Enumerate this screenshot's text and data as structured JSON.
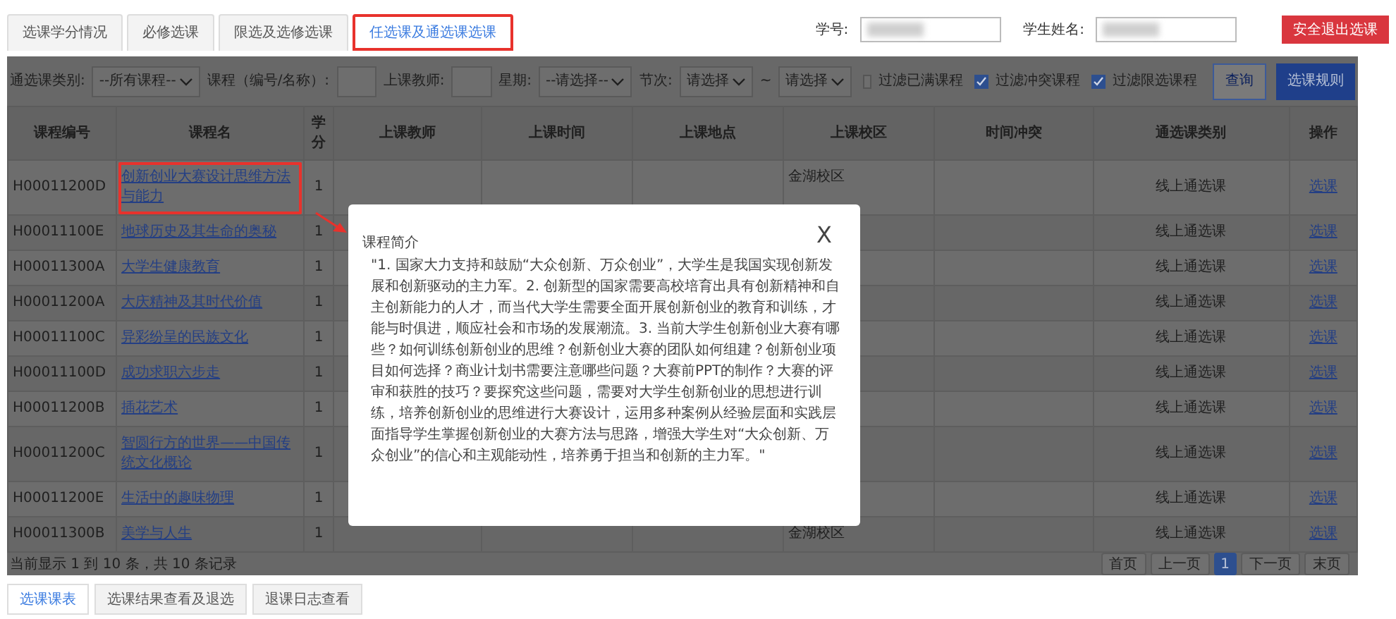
{
  "top_tabs": [
    {
      "label": "选课学分情况",
      "selected": false,
      "highlighted": false
    },
    {
      "label": "必修选课",
      "selected": false,
      "highlighted": false
    },
    {
      "label": "限选及选修选课",
      "selected": false,
      "highlighted": false
    },
    {
      "label": "任选课及通选课选课",
      "selected": true,
      "highlighted": true
    }
  ],
  "student": {
    "id_label": "学号:",
    "name_label": "学生姓名:",
    "logout_button": "安全退出选课"
  },
  "filters": {
    "fields": [
      {
        "kind": "select",
        "label": "通选课类别:",
        "value": "--所有课程--"
      },
      {
        "kind": "input",
        "label": "课程（编号/名称）:"
      },
      {
        "kind": "input",
        "label": "上课教师:"
      },
      {
        "kind": "select",
        "label": "星期:",
        "value": "--请选择--"
      },
      {
        "kind": "range",
        "label": "节次:",
        "value": "请选择",
        "separator": "~",
        "value_to": "请选择"
      }
    ],
    "checkboxes": [
      {
        "label": "过滤已满课程",
        "checked": false
      },
      {
        "label": "过滤冲突课程",
        "checked": true
      },
      {
        "label": "过滤限选课程",
        "checked": true
      }
    ],
    "buttons": [
      {
        "label": "查询",
        "kind": "outline"
      },
      {
        "label": "选课规则",
        "kind": "primary"
      }
    ]
  },
  "table": {
    "columns": [
      "课程编号",
      "课程名",
      "学分",
      "上课教师",
      "上课时间",
      "上课地点",
      "上课校区",
      "时间冲突",
      "通选课类别",
      "操作"
    ],
    "rows": [
      {
        "code": "H00011200D",
        "name": "创新创业大赛设计思维方法与能力",
        "credit": "1",
        "campus": "金湖校区",
        "category": "线上通选课",
        "action": "选课",
        "highlighted": true
      },
      {
        "code": "H00011100E",
        "name": "地球历史及其生命的奥秘",
        "credit": "1",
        "category": "线上通选课",
        "action": "选课",
        "highlighted": false
      },
      {
        "code": "H00011300A",
        "name": "大学生健康教育",
        "credit": "1",
        "category": "线上通选课",
        "action": "选课",
        "highlighted": false
      },
      {
        "code": "H00011200A",
        "name": "大庆精神及其时代价值",
        "credit": "1",
        "category": "线上通选课",
        "action": "选课",
        "highlighted": false
      },
      {
        "code": "H00011100C",
        "name": "异彩纷呈的民族文化",
        "credit": "1",
        "category": "线上通选课",
        "action": "选课",
        "highlighted": false
      },
      {
        "code": "H00011100D",
        "name": "成功求职六步走",
        "credit": "1",
        "category": "线上通选课",
        "action": "选课",
        "highlighted": false
      },
      {
        "code": "H00011200B",
        "name": "插花艺术",
        "credit": "1",
        "category": "线上通选课",
        "action": "选课",
        "highlighted": false
      },
      {
        "code": "H00011200C",
        "name": "智圆行方的世界——中国传统文化概论",
        "credit": "1",
        "category": "线上通选课",
        "action": "选课",
        "highlighted": false
      },
      {
        "code": "H00011200E",
        "name": "生活中的趣味物理",
        "credit": "1",
        "category": "线上通选课",
        "action": "选课",
        "highlighted": false
      },
      {
        "code": "H00011300B",
        "name": "美学与人生",
        "credit": "1",
        "campus": "金湖校区",
        "category": "线上通选课",
        "action": "选课",
        "highlighted": false
      }
    ],
    "summary": "当前显示 1 到 10 条，共 10 条记录",
    "pagination": [
      {
        "label": "首页",
        "selected": false
      },
      {
        "label": "上一页",
        "selected": false
      },
      {
        "label": "1",
        "selected": true
      },
      {
        "label": "下一页",
        "selected": false
      },
      {
        "label": "末页",
        "selected": false
      }
    ]
  },
  "modal": {
    "title": "课程简介",
    "close": "X",
    "text": "\"1. 国家大力支持和鼓励“大众创新、万众创业”，大学生是我国实现创新发展和创新驱动的主力军。2. 创新型的国家需要高校培育出具有创新精神和自主创新能力的人才，而当代大学生需要全面开展创新创业的教育和训练，才能与时俱进，顺应社会和市场的发展潮流。3. 当前大学生创新创业大赛有哪些？如何训练创新创业的思维？创新创业大赛的团队如何组建？创新创业项目如何选择？商业计划书需要注意哪些问题？大赛前PPT的制作？大赛的评审和获胜的技巧？要探究这些问题，需要对大学生创新创业的思想进行训练，培养创新创业的思维进行大赛设计，运用多种案例从经验层面和实践层面指导学生掌握创新创业的大赛方法与思路，增强大学生对“大众创新、万众创业”的信心和主观能动性，培养勇于担当和创新的主力军。\""
  },
  "bottom_tabs": [
    {
      "label": "选课课表",
      "selected": true
    },
    {
      "label": "选课结果查看及退选",
      "selected": false
    },
    {
      "label": "退课日志查看",
      "selected": false
    }
  ]
}
